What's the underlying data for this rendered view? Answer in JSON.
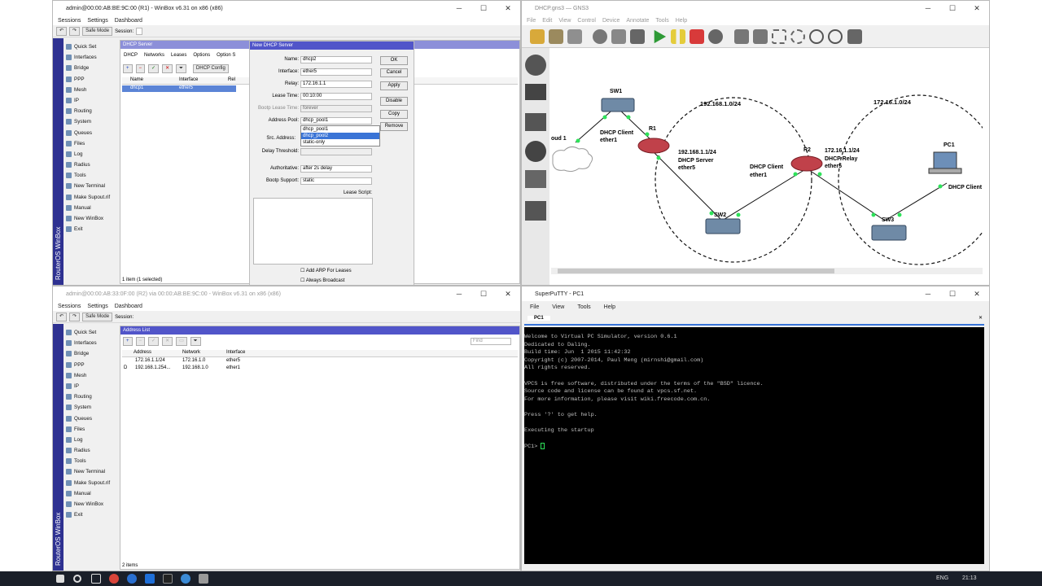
{
  "winbox1": {
    "title": "admin@00:00:AB:BE:9C:00 (R1) - WinBox v6.31 on x86 (x86)",
    "menu": [
      "Sessions",
      "Settings",
      "Dashboard"
    ],
    "safe_mode": "Safe Mode",
    "session_label": "Session:",
    "sidebar_brand": "RouterOS WinBox",
    "nav": [
      "Quick Set",
      "Interfaces",
      "Bridge",
      "PPP",
      "Mesh",
      "IP",
      "Routing",
      "System",
      "Queues",
      "Files",
      "Log",
      "Radius",
      "Tools",
      "New Terminal",
      "Make Supout.rif",
      "Manual",
      "New WinBox",
      "Exit"
    ],
    "dhcp_window": {
      "title": "DHCP Server",
      "tabs": [
        "DHCP",
        "Networks",
        "Leases",
        "Options",
        "Option S"
      ],
      "config_btn": "DHCP Config",
      "find_placeholder": "Find",
      "cols": [
        "Name",
        "Interface",
        "Rel"
      ],
      "row": {
        "name": "dhcp1",
        "interface": "ether5"
      },
      "status": "1 item (1 selected)"
    },
    "new_dhcp": {
      "title": "New DHCP Server",
      "labels": {
        "name": "Name:",
        "interface": "Interface:",
        "relay": "Relay:",
        "lease_time": "Lease Time:",
        "bootp_lease_time": "Bootp Lease Time:",
        "address_pool": "Address Pool:",
        "src_address": "Src. Address:",
        "delay_threshold": "Delay Threshold:",
        "authoritative": "Authoritative:",
        "bootp_support": "Bootp Support:",
        "lease_script": "Lease Script:"
      },
      "values": {
        "name": "dhcp2",
        "interface": "ether5",
        "relay": "172.16.1.1",
        "lease_time": "00:10:00",
        "bootp_lease_time": "forever",
        "address_pool": "dhcp_pool1",
        "authoritative": "after 2s delay",
        "bootp_support": "static"
      },
      "pool_options": [
        "dhcp_pool1",
        "dhcp_pool2",
        "static-only"
      ],
      "buttons": [
        "OK",
        "Cancel",
        "Apply",
        "Disable",
        "Copy",
        "Remove"
      ],
      "checkboxes": [
        "Add ARP For Leases",
        "Always Broadcast"
      ]
    }
  },
  "winbox2": {
    "title": "admin@00:00:AB:33:0F:00 (R2) via 00:00:AB:BE:9C:00 - WinBox v6.31 on x86 (x86)",
    "menu": [
      "Sessions",
      "Settings",
      "Dashboard"
    ],
    "safe_mode": "Safe Mode",
    "session_label": "Session:",
    "sidebar_brand": "RouterOS WinBox",
    "nav": [
      "Quick Set",
      "Interfaces",
      "Bridge",
      "PPP",
      "Mesh",
      "IP",
      "Routing",
      "System",
      "Queues",
      "Files",
      "Log",
      "Radius",
      "Tools",
      "New Terminal",
      "Make Supout.rif",
      "Manual",
      "New WinBox",
      "Exit"
    ],
    "address_list": {
      "title": "Address List",
      "find_placeholder": "Find",
      "cols": [
        "Address",
        "Network",
        "Interface"
      ],
      "rows": [
        {
          "flag": "",
          "address": "172.16.1.1/24",
          "network": "172.16.1.0",
          "interface": "ether5"
        },
        {
          "flag": "D",
          "address": "192.168.1.254...",
          "network": "192.168.1.0",
          "interface": "ether1"
        }
      ],
      "status": "2 items"
    }
  },
  "gns3": {
    "title": "DHCP.gns3 — GNS3",
    "menu": [
      "File",
      "Edit",
      "View",
      "Control",
      "Device",
      "Annotate",
      "Tools",
      "Help"
    ],
    "labels": {
      "sw1": "SW1",
      "sw2": "SW2",
      "sw3": "SW3",
      "r1": "R1",
      "r2": "R2",
      "pc1": "PC1",
      "cloud": "oud 1",
      "net1": "192.168.1.0/24",
      "net2": "172.16.1.0/24",
      "dhcp_client_ether1": "DHCP Client\nether1",
      "r1_info": "192.168.1.1/24\nDHCP Server\nether5",
      "r2_client": "DHCP Client\nether1",
      "r2_info": "172.16.1.1/24\nDHCP Relay\nether5",
      "pc_client": "DHCP Client"
    }
  },
  "putty": {
    "title": "SuperPuTTY - PC1",
    "menu": [
      "File",
      "View",
      "Tools",
      "Help"
    ],
    "tab": "PC1",
    "lines": [
      "Welcome to Virtual PC Simulator, version 0.6.1",
      "Dedicated to Daling.",
      "Build time: Jun  1 2015 11:42:32",
      "Copyright (c) 2007-2014, Paul Meng (mirnshi@gmail.com)",
      "All rights reserved.",
      "",
      "VPCS is free software, distributed under the terms of the \"BSD\" licence.",
      "Source code and license can be found at vpcs.sf.net.",
      "For more information, please visit wiki.freecode.com.cn.",
      "",
      "Press '?' to get help.",
      "",
      "Executing the startup",
      "",
      "PC1> "
    ]
  },
  "taskbar": {
    "lang": "ENG",
    "time": "21:13"
  }
}
